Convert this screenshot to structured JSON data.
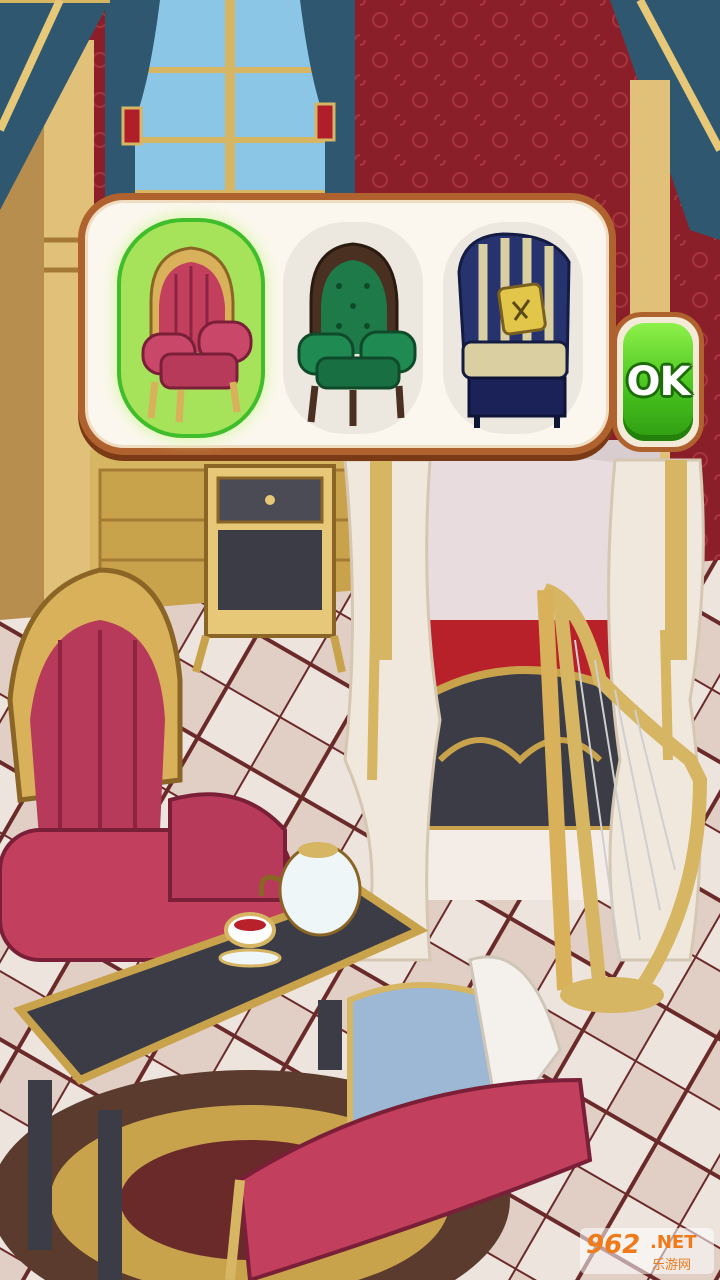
{
  "selector": {
    "options": [
      {
        "name": "pink-baroque-armchair",
        "selected": true
      },
      {
        "name": "green-tufted-armchair",
        "selected": false
      },
      {
        "name": "blue-striped-wingback-chair",
        "selected": false
      }
    ],
    "confirm_label": "OK"
  },
  "colors": {
    "panel_border": "#b0622e",
    "selected_highlight": "#a6e25a",
    "ok_green": "#47c41e",
    "wallpaper": "#8a1f2a",
    "gold": "#d9b15a"
  },
  "watermark": {
    "logo": "962",
    "suffix": ".NET",
    "sub": "乐游网"
  }
}
